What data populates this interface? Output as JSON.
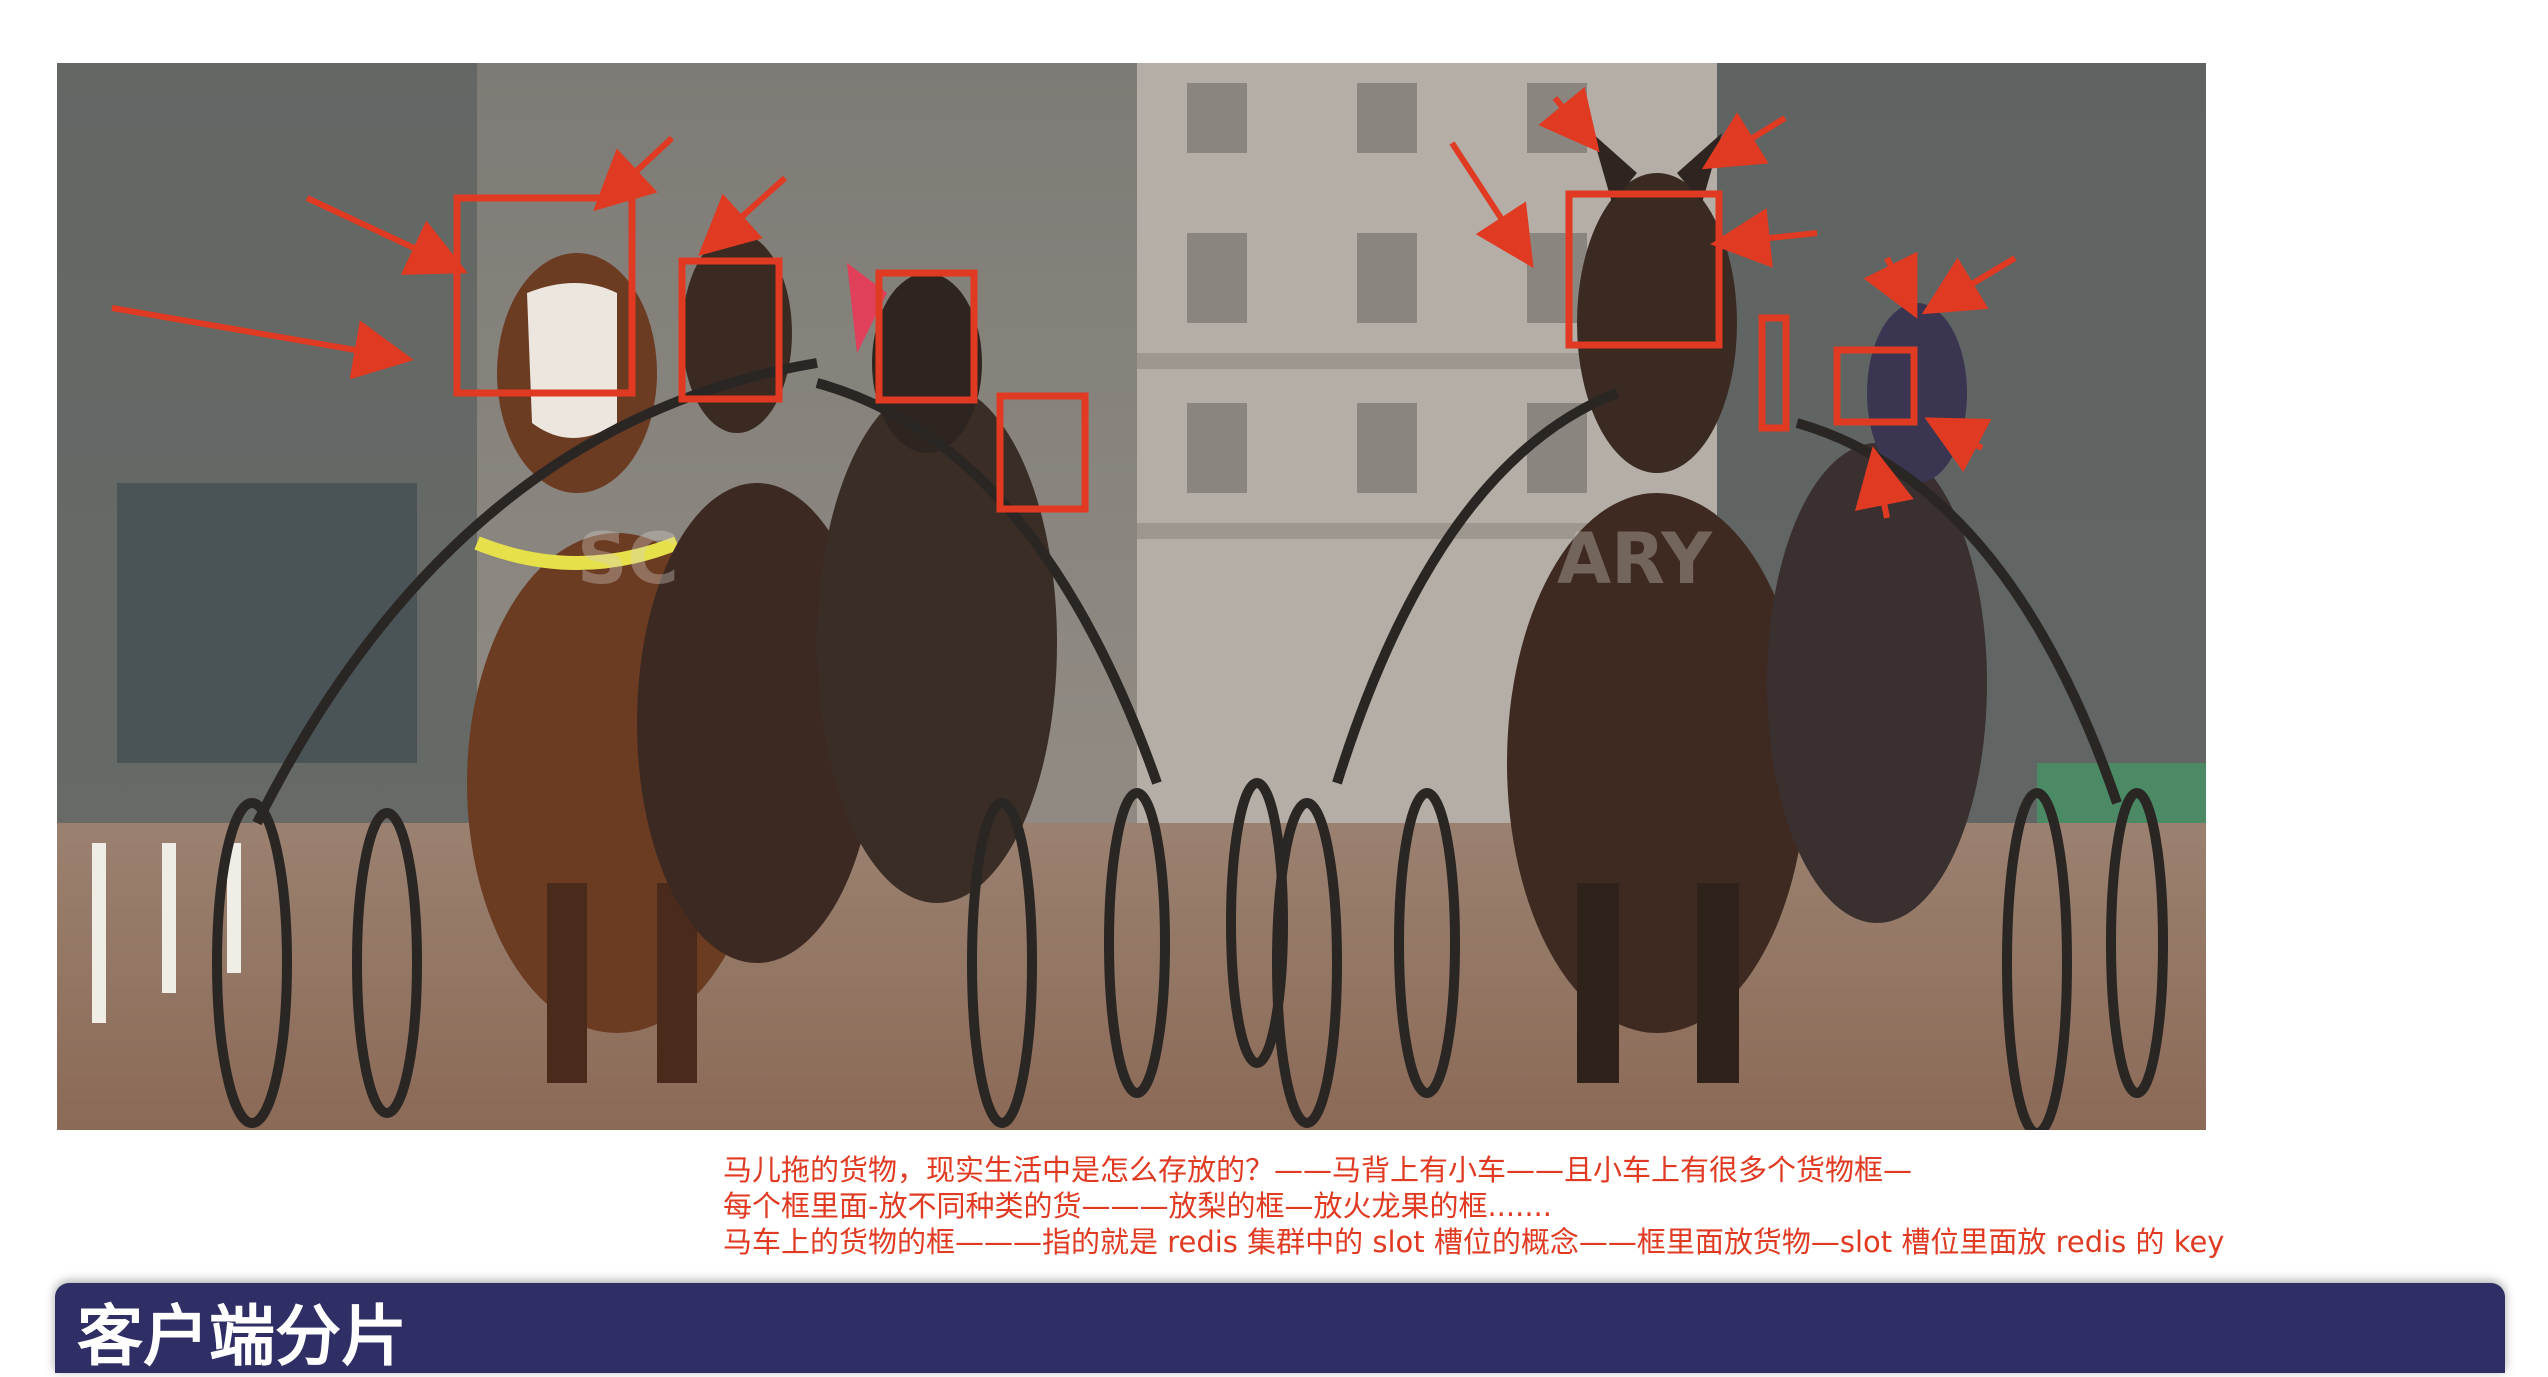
{
  "figure": {
    "caption_lines": [
      "马儿拖的货物，现实生活中是怎么存放的？——马背上有小车——且小车上有很多个货物框—",
      "每个框里面-放不同种类的货———放梨的框—放火龙果的框.......",
      "马车上的货物的框———指的就是 redis 集群中的 slot 槽位的概念——框里面放货物—slot 槽位里面放 redis 的 key"
    ],
    "annotation_color": "#e03a22"
  },
  "section": {
    "title": "客户端分片",
    "background": "#2f2f66"
  }
}
